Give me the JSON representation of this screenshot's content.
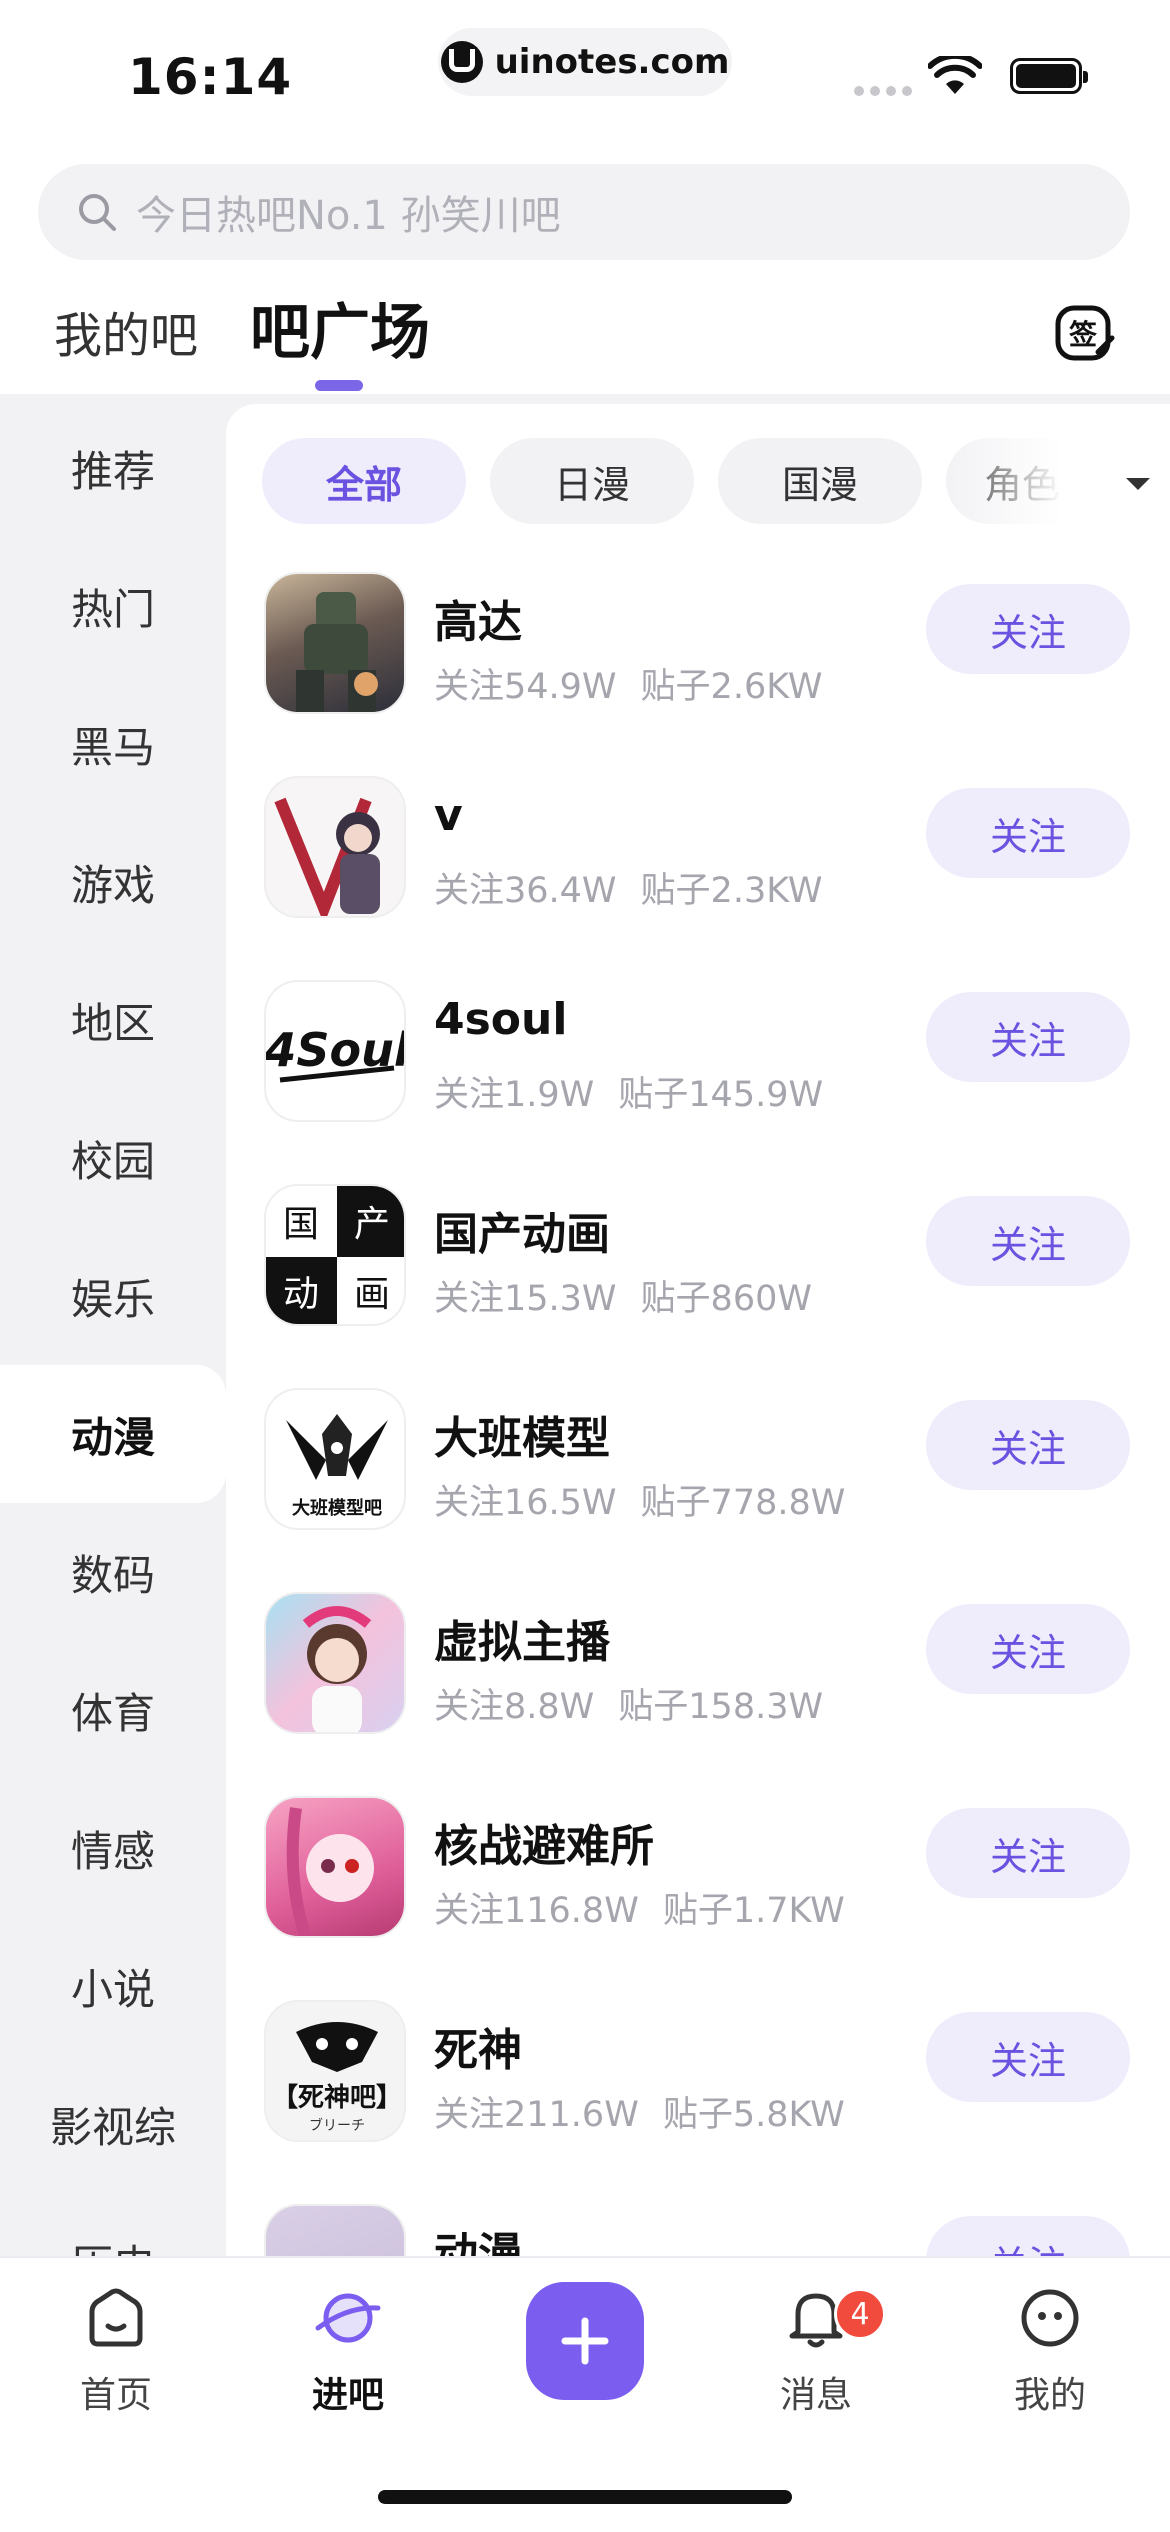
{
  "status_bar": {
    "time": "16:14",
    "url": "uinotes.com"
  },
  "search": {
    "placeholder": "今日热吧No.1 孙笑川吧"
  },
  "top_tabs": {
    "mine": "我的吧",
    "square": "吧广场",
    "sign_icon": "sign-in-icon"
  },
  "sidebar": {
    "items": [
      "推荐",
      "热门",
      "黑马",
      "游戏",
      "地区",
      "校园",
      "娱乐",
      "动漫",
      "数码",
      "体育",
      "情感",
      "小说",
      "影视综",
      "历史"
    ],
    "active": "动漫"
  },
  "chips": {
    "items": [
      "全部",
      "日漫",
      "国漫",
      "角色"
    ],
    "active": "全部"
  },
  "bars": [
    {
      "name": "高达",
      "followers": "关注54.9W",
      "posts": "贴子2.6KW",
      "follow_label": "关注",
      "avatar_color": "#6b5a52"
    },
    {
      "name": "v",
      "followers": "关注36.4W",
      "posts": "贴子2.3KW",
      "follow_label": "关注",
      "avatar_color": "#b32838"
    },
    {
      "name": "4soul",
      "followers": "关注1.9W",
      "posts": "贴子145.9W",
      "follow_label": "关注",
      "avatar_color": "#ffffff"
    },
    {
      "name": "国产动画",
      "followers": "关注15.3W",
      "posts": "贴子860W",
      "follow_label": "关注",
      "avatar_color": "#111111"
    },
    {
      "name": "大班模型",
      "followers": "关注16.5W",
      "posts": "贴子778.8W",
      "follow_label": "关注",
      "avatar_color": "#ffffff"
    },
    {
      "name": "虚拟主播",
      "followers": "关注8.8W",
      "posts": "贴子158.3W",
      "follow_label": "关注",
      "avatar_color": "#e78cc0"
    },
    {
      "name": "核战避难所",
      "followers": "关注116.8W",
      "posts": "贴子1.7KW",
      "follow_label": "关注",
      "avatar_color": "#e0609a"
    },
    {
      "name": "死神",
      "followers": "关注211.6W",
      "posts": "贴子5.8KW",
      "follow_label": "关注",
      "avatar_color": "#f4f4f4"
    },
    {
      "name": "动漫",
      "followers": "",
      "posts": "",
      "follow_label": "关注",
      "avatar_color": "#c9bcd9"
    }
  ],
  "bottom_nav": {
    "home": "首页",
    "jinba": "进吧",
    "messages": "消息",
    "me": "我的",
    "message_badge": "4"
  },
  "colors": {
    "accent": "#7b5ef0",
    "accent_light": "#efedfb",
    "badge": "#f04b3c"
  }
}
